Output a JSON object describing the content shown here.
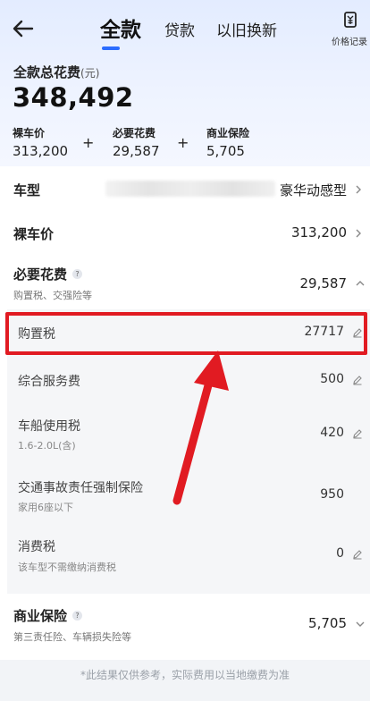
{
  "header": {
    "tabs": [
      {
        "label": "全款",
        "active": true
      },
      {
        "label": "贷款",
        "active": false
      },
      {
        "label": "以旧换新",
        "active": false
      }
    ],
    "price_record_label": "价格记录"
  },
  "summary": {
    "title": "全款总花费",
    "unit": "(元)",
    "total": "348,492",
    "components": [
      {
        "label": "裸车价",
        "value": "313,200"
      },
      {
        "label": "必要花费",
        "value": "29,587"
      },
      {
        "label": "商业保险",
        "value": "5,705"
      }
    ],
    "plus": "+"
  },
  "rows": {
    "model": {
      "label": "车型",
      "value": "豪华动感型"
    },
    "bare_price": {
      "label": "裸车价",
      "value": "313,200"
    },
    "required": {
      "label": "必要花费",
      "sub": "购置税、交强险等",
      "value": "29,587",
      "help": "?"
    },
    "insurance": {
      "label": "商业保险",
      "sub": "第三责任险、车辆损失险等",
      "value": "5,705",
      "help": "?"
    }
  },
  "required_items": [
    {
      "label": "购置税",
      "value": "27717"
    },
    {
      "label": "综合服务费",
      "value": "500"
    },
    {
      "label": "车船使用税",
      "sub": "1.6-2.0L(含)",
      "value": "420"
    },
    {
      "label": "交通事故责任强制保险",
      "sub": "家用6座以下",
      "value": "950"
    },
    {
      "label": "消费税",
      "sub": "该车型不需缴纳消费税",
      "value": "0"
    }
  ],
  "disclaimer": "*此结果仅供参考，实际费用以当地缴费为准",
  "colors": {
    "accent": "#2b6cff",
    "highlight": "#e11b22"
  }
}
